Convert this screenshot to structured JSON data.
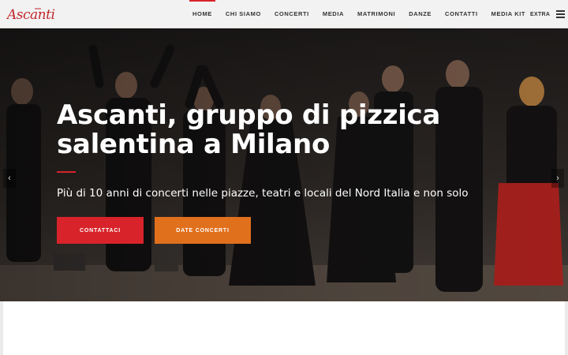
{
  "header": {
    "logo_text": "Ascanti",
    "nav": [
      {
        "label": "HOME",
        "active": true
      },
      {
        "label": "CHI SIAMO",
        "active": false
      },
      {
        "label": "CONCERTI",
        "active": false
      },
      {
        "label": "MEDIA",
        "active": false
      },
      {
        "label": "MATRIMONI",
        "active": false
      },
      {
        "label": "DANZE",
        "active": false
      },
      {
        "label": "CONTATTI",
        "active": false
      },
      {
        "label": "MEDIA KIT",
        "active": false
      }
    ],
    "extra_label": "EXTRA",
    "menu_icon": "hamburger-menu-icon"
  },
  "hero": {
    "title": "Ascanti, gruppo di pizzica salentina a Milano",
    "subtitle": "Più di 10 anni di concerti nelle piazze, teatri e locali del Nord Italia e non solo",
    "buttons": {
      "contact": "CONTATTACI",
      "dates": "DATE CONCERTI"
    },
    "arrow_left": "‹",
    "arrow_right": "›"
  },
  "colors": {
    "accent_red": "#d8232a",
    "accent_orange": "#e1701d",
    "header_bg": "#f2f2f2"
  }
}
